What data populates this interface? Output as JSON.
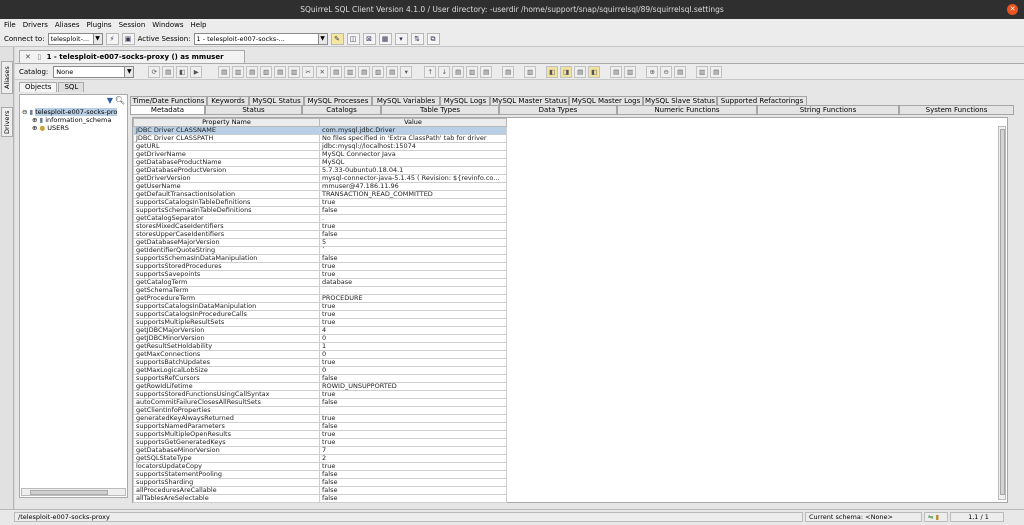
{
  "window": {
    "title": "SQuirreL SQL Client Version 4.1.0 / User directory: -userdir /home/support/snap/squirrelsql/89/squirrelsql.settings"
  },
  "menu": [
    "File",
    "Drivers",
    "Aliases",
    "Plugins",
    "Session",
    "Windows",
    "Help"
  ],
  "connect": {
    "label": "Connect to:",
    "value": "telesploit-...",
    "session_label": "Active Session:",
    "session_value": "1 - telesploit-e007-socks-..."
  },
  "side_tabs": {
    "aliases": "Aliases",
    "drivers": "Drivers"
  },
  "session_tab": {
    "title": "1 - telesploit-e007-socks-proxy () as mmuser"
  },
  "catalog": {
    "label": "Catalog:",
    "value": "None"
  },
  "subtabs": {
    "objects": "Objects",
    "sql": "SQL"
  },
  "tree": {
    "root": "telesploit-e007-socks-pro",
    "children": [
      "information_schema",
      "USERS"
    ]
  },
  "tabs_row1": [
    "Time/Date Functions",
    "Keywords",
    "MySQL Status",
    "MySQL Processes",
    "MySQL Variables",
    "MySQL Logs",
    "MySQL Master Status",
    "MySQL Master Logs",
    "MySQL Slave Status",
    "Supported Refactorings"
  ],
  "tabs_row2": [
    "Metadata",
    "Status",
    "Catalogs",
    "Table Types",
    "Data Types",
    "Numeric Functions",
    "String Functions",
    "System Functions"
  ],
  "table": {
    "headers": [
      "Property Name",
      "Value"
    ],
    "rows": [
      [
        "JDBC Driver CLASSNAME",
        "com.mysql.jdbc.Driver"
      ],
      [
        "JDBC Driver CLASSPATH",
        "No files specified in 'Extra ClassPath' tab for driver"
      ],
      [
        "getURL",
        "jdbc:mysql://localhost:15074"
      ],
      [
        "getDriverName",
        "MySQL Connector Java"
      ],
      [
        "getDatabaseProductName",
        "MySQL"
      ],
      [
        "getDatabaseProductVersion",
        "5.7.33-0ubuntu0.18.04.1"
      ],
      [
        "getDriverVersion",
        "mysql-connector-java-5.1.45 ( Revision: ${revinfo.co..."
      ],
      [
        "getUserName",
        "mmuser@47.186.11.96"
      ],
      [
        "getDefaultTransactionIsolation",
        "TRANSACTION_READ_COMMITTED"
      ],
      [
        "supportsCatalogsInTableDefinitions",
        "true"
      ],
      [
        "supportsSchemasInTableDefinitions",
        "false"
      ],
      [
        "getCatalogSeparator",
        "."
      ],
      [
        "storesMixedCaseIdentifiers",
        "true"
      ],
      [
        "storesUpperCaseIdentifiers",
        "false"
      ],
      [
        "getDatabaseMajorVersion",
        "5"
      ],
      [
        "getIdentifierQuoteString",
        "`"
      ],
      [
        "supportsSchemasInDataManipulation",
        "false"
      ],
      [
        "supportsStoredProcedures",
        "true"
      ],
      [
        "supportsSavepoints",
        "true"
      ],
      [
        "getCatalogTerm",
        "database"
      ],
      [
        "getSchemaTerm",
        ""
      ],
      [
        "getProcedureTerm",
        "PROCEDURE"
      ],
      [
        "supportsCatalogsInDataManipulation",
        "true"
      ],
      [
        "supportsCatalogsInProcedureCalls",
        "true"
      ],
      [
        "supportsMultipleResultSets",
        "true"
      ],
      [
        "getJDBCMajorVersion",
        "4"
      ],
      [
        "getJDBCMinorVersion",
        "0"
      ],
      [
        "getResultSetHoldability",
        "1"
      ],
      [
        "getMaxConnections",
        "0"
      ],
      [
        "supportsBatchUpdates",
        "true"
      ],
      [
        "getMaxLogicalLobSize",
        "0"
      ],
      [
        "supportsRefCursors",
        "false"
      ],
      [
        "getRowIdLifetime",
        "ROWID_UNSUPPORTED"
      ],
      [
        "supportsStoredFunctionsUsingCallSyntax",
        "true"
      ],
      [
        "autoCommitFailureClosesAllResultSets",
        "false"
      ],
      [
        "getClientInfoProperties",
        ""
      ],
      [
        "generatedKeyAlwaysReturned",
        "true"
      ],
      [
        "supportsNamedParameters",
        "false"
      ],
      [
        "supportsMultipleOpenResults",
        "true"
      ],
      [
        "supportsGetGeneratedKeys",
        "true"
      ],
      [
        "getDatabaseMinorVersion",
        "7"
      ],
      [
        "getSQLStateType",
        "2"
      ],
      [
        "locatorsUpdateCopy",
        "true"
      ],
      [
        "supportsStatementPooling",
        "false"
      ],
      [
        "supportsSharding",
        "false"
      ],
      [
        "allProceduresAreCallable",
        "false"
      ],
      [
        "allTablesAreSelectable",
        "false"
      ]
    ]
  },
  "status": {
    "left": "/telesploit-e007-socks-proxy",
    "schema": "Current schema: <None>",
    "position": "1,1 / 1"
  }
}
